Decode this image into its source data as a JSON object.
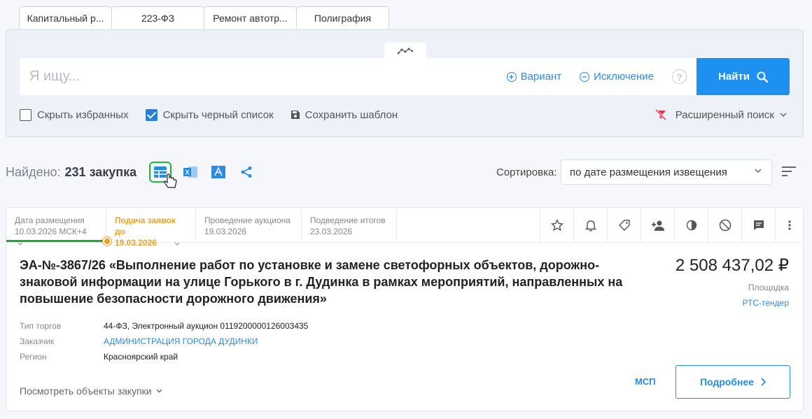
{
  "tabs": [
    {
      "label": "Капитальный р..."
    },
    {
      "label": "223-ФЗ"
    },
    {
      "label": "Ремонт автотр..."
    },
    {
      "label": "Полиграфия"
    }
  ],
  "search": {
    "placeholder": "Я ищу...",
    "value": "",
    "variant_label": "Вариант",
    "exclusion_label": "Исключение",
    "help_label": "?",
    "find_label": "Найти"
  },
  "options": {
    "hide_favorites": {
      "label": "Скрыть избранных",
      "checked": false
    },
    "hide_blacklist": {
      "label": "Скрыть черный список",
      "checked": true
    },
    "save_template": "Сохранить шаблон",
    "advanced_search": "Расширенный поиск"
  },
  "results": {
    "found_label": "Найдено:",
    "found_count": "231 закупка",
    "sort_label": "Сортировка:",
    "sort_value": "по дате размещения извещения"
  },
  "card": {
    "stages": [
      {
        "title": "Дата размещения",
        "value": "10.03.2026 МСК+4",
        "active": false,
        "dropdown": true
      },
      {
        "title": "Подача заявок до",
        "value": "19.03.2026",
        "active": true,
        "dropdown": true
      },
      {
        "title": "Проведение аукциона",
        "value": "19.03.2026",
        "active": false,
        "dropdown": false
      },
      {
        "title": "Подведение итогов",
        "value": "23.03.2026",
        "active": false,
        "dropdown": false
      }
    ],
    "progress_fraction": 0.27,
    "title": "ЭА-№-3867/26 «Выполнение работ по установке и замене светофорных объектов, дорожно-знаковой информации на улице Горького в г. Дудинка в рамках мероприятий, направленных на повышение безопасности дорожного движения»",
    "price": "2 508 437,02 ₽",
    "platform_label": "Площадка",
    "platform_value": "РТС-тендер",
    "meta": {
      "type_label": "Тип торгов",
      "type_value": "44-ФЗ, Электронный аукцион 0119200000126003435",
      "customer_label": "Заказчик",
      "customer_value": "АДМИНИСТРАЦИЯ ГОРОДА ДУДИНКИ",
      "region_label": "Регион",
      "region_value": "Красноярский край"
    },
    "view_objects": "Посмотреть объекты закупки",
    "msp": "МСП",
    "details": "Подробнее"
  },
  "colors": {
    "accent": "#1e90f0",
    "link": "#2b8be0",
    "active_stage": "#f0a020",
    "progress": "#22a83a",
    "highlight_border": "#22b83a"
  }
}
